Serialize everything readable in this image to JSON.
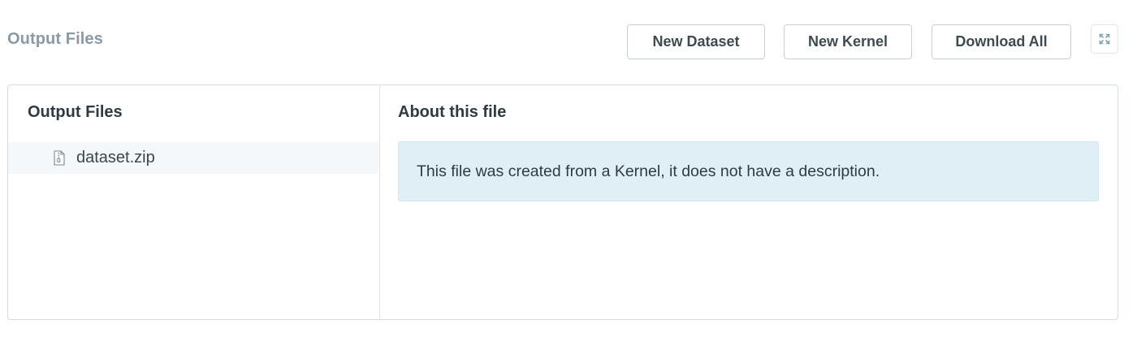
{
  "header": {
    "title": "Output Files",
    "buttons": {
      "new_dataset": "New Dataset",
      "new_kernel": "New Kernel",
      "download_all": "Download All"
    },
    "expand_icon": "expand-icon"
  },
  "left_pane": {
    "heading": "Output Files",
    "files": [
      {
        "name": "dataset.zip",
        "icon": "zip-file-icon"
      }
    ]
  },
  "right_pane": {
    "heading": "About this file",
    "description": "This file was created from a Kernel, it does not have a description."
  },
  "colors": {
    "info_background": "#e0eff5",
    "selected_row": "#f4f8fa",
    "border": "#d5dde2",
    "muted_title": "#8a9aa4",
    "heading_text": "#2f3b42"
  }
}
